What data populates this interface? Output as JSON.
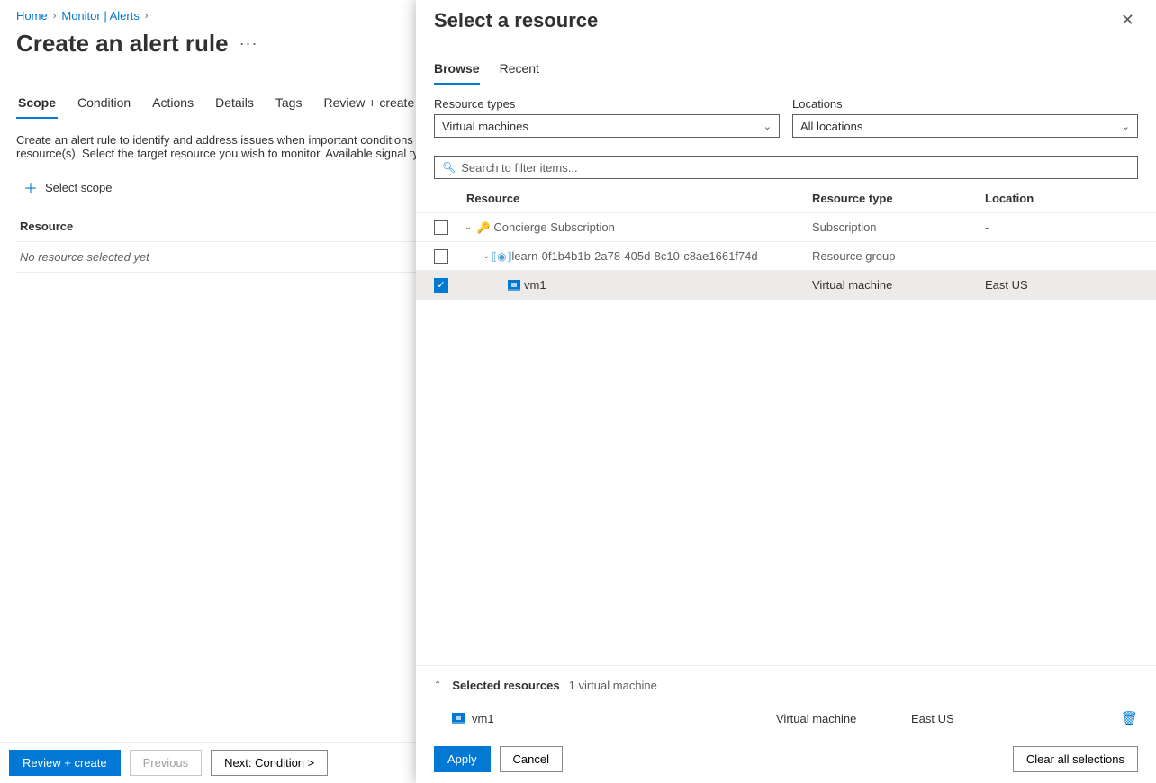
{
  "breadcrumb": {
    "home": "Home",
    "monitor": "Monitor | Alerts"
  },
  "page_title": "Create an alert rule",
  "main_tabs": [
    "Scope",
    "Condition",
    "Actions",
    "Details",
    "Tags",
    "Review + create"
  ],
  "instruction": "Create an alert rule to identify and address issues when important conditions are found in your monitoring data. When defining the alert rule scope, you will be able to define conditions based on the selected resource(s). Select the target resource you wish to monitor. Available signal types for your selected resource(s) will show up on the bottom right.",
  "select_scope_label": "Select scope",
  "resource_header": "Resource",
  "resource_empty": "No resource selected yet",
  "footer": {
    "review_create": "Review + create",
    "previous": "Previous",
    "next": "Next: Condition  >"
  },
  "panel": {
    "title": "Select a resource",
    "tabs": [
      "Browse",
      "Recent"
    ],
    "filters": {
      "resource_types_label": "Resource types",
      "resource_types_value": "Virtual machines",
      "locations_label": "Locations",
      "locations_value": "All locations"
    },
    "search_placeholder": "Search to filter items...",
    "columns": {
      "resource": "Resource",
      "type": "Resource type",
      "location": "Location"
    },
    "rows": {
      "sub_name": "Concierge Subscription",
      "sub_type": "Subscription",
      "sub_loc": "-",
      "rg_name": "learn-0f1b4b1b-2a78-405d-8c10-c8ae1661f74d",
      "rg_type": "Resource group",
      "rg_loc": "-",
      "vm_name": "vm1",
      "vm_type": "Virtual machine",
      "vm_loc": "East US"
    },
    "selected": {
      "header": "Selected resources",
      "count": "1 virtual machine",
      "name": "vm1",
      "type": "Virtual machine",
      "location": "East US"
    },
    "footer": {
      "apply": "Apply",
      "cancel": "Cancel",
      "clear": "Clear all selections"
    }
  }
}
